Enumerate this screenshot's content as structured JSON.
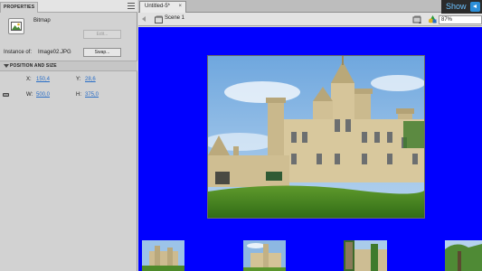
{
  "properties": {
    "tab_label": "PROPERTIES",
    "symbol_type": "Bitmap",
    "edit_label": "Edit...",
    "instance_label": "Instance of:",
    "instance_name": "Image02.JPG",
    "swap_label": "Swap...",
    "section_title": "POSITION AND SIZE",
    "x_label": "X:",
    "x_value": "150,4",
    "y_label": "Y:",
    "y_value": "28,6",
    "w_label": "W:",
    "w_value": "500,0",
    "h_label": "H:",
    "h_value": "375,0"
  },
  "document": {
    "tab_title": "Untitled-5*",
    "tab_close": "×",
    "scene_label": "Scene 1",
    "zoom": "87%",
    "stage_color": "#0000ff"
  },
  "overlay": {
    "show_label": "Show"
  },
  "icons": [
    "bitmap-icon",
    "lock-icon",
    "back-arrow-icon",
    "scene-icon",
    "edit-scene-icon",
    "edit-symbol-icon",
    "close-icon",
    "panel-menu-icon",
    "show-icon"
  ]
}
